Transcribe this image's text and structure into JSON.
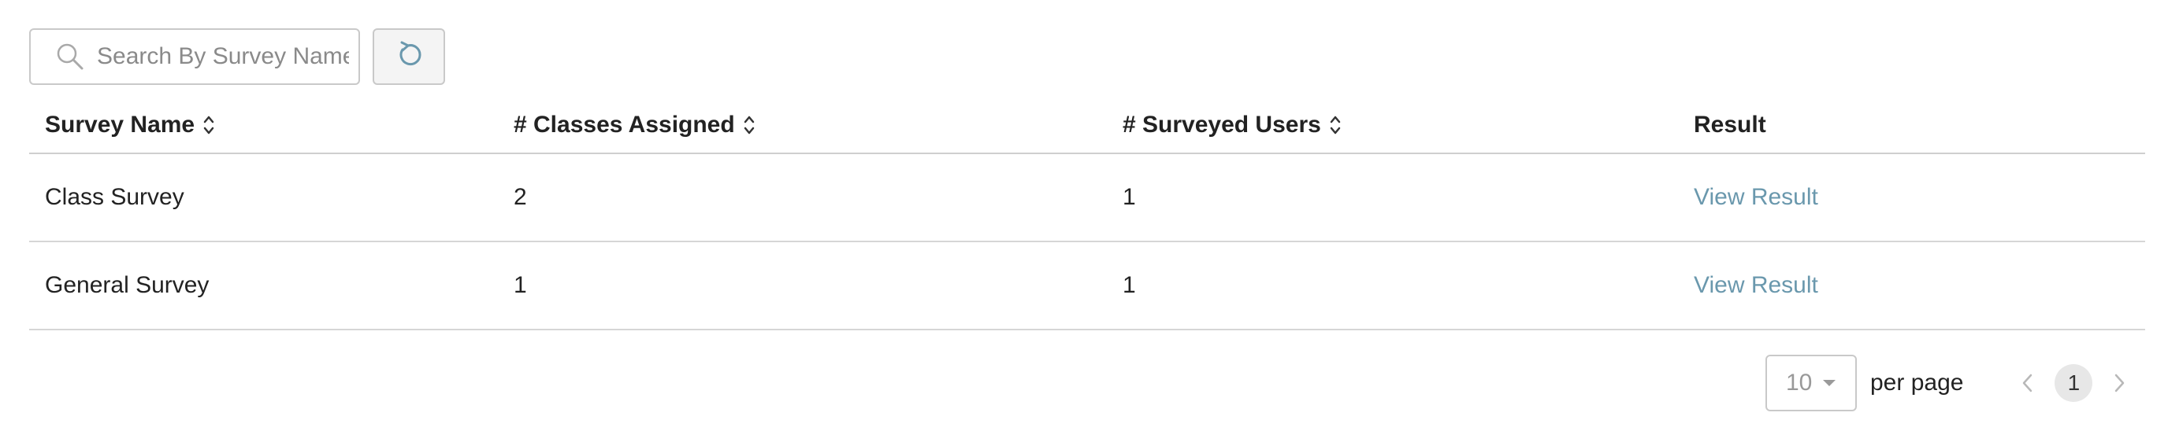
{
  "search": {
    "placeholder": "Search By Survey Name",
    "icon": "search-icon"
  },
  "refresh": {
    "icon": "refresh-icon"
  },
  "table": {
    "columns": [
      {
        "label": "Survey Name",
        "sortable": true
      },
      {
        "label": "# Classes Assigned",
        "sortable": true
      },
      {
        "label": "# Surveyed Users",
        "sortable": true
      },
      {
        "label": "Result",
        "sortable": false
      }
    ],
    "rows": [
      {
        "survey_name": "Class Survey",
        "classes_assigned": "2",
        "surveyed_users": "1",
        "result_link": "View Result"
      },
      {
        "survey_name": "General Survey",
        "classes_assigned": "1",
        "surveyed_users": "1",
        "result_link": "View Result"
      }
    ]
  },
  "pagination": {
    "page_size": "10",
    "per_page_label": "per page",
    "current_page": "1"
  },
  "colors": {
    "link": "#6a98ad",
    "border": "#c9c9c9",
    "active_page_bg": "#e7e7e7"
  }
}
